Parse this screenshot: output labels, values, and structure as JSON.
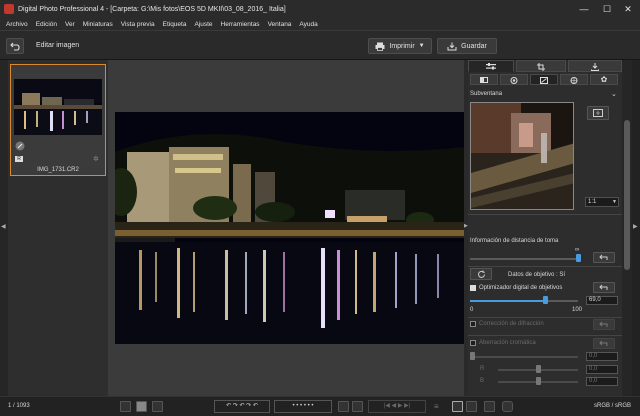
{
  "titlebar": {
    "title": "Digital Photo Professional 4 - [Carpeta: G:\\Mis fotos\\EOS 5D MKII\\03_08_2016_ Italia]",
    "minimize": "—",
    "maximize": "☐",
    "close": "✕"
  },
  "menu": {
    "items": [
      "Archivo",
      "Edición",
      "Ver",
      "Miniaturas",
      "Vista previa",
      "Etiqueta",
      "Ajuste",
      "Herramientas",
      "Ventana",
      "Ayuda"
    ]
  },
  "toolbar": {
    "back_icon": "back-arrow-icon",
    "mode_label": "Editar imagen",
    "print_label": "Imprimir",
    "save_label": "Guardar"
  },
  "filmstrip": {
    "thumb_filename": "IMG_1731.CR2",
    "thumb_badge": "R"
  },
  "panel": {
    "subwindow_label": "Subventana",
    "zoom_value": "1:1",
    "distance_label": "Información de distancia de toma",
    "lens_data_label": "Datos de objetivo : Sí",
    "dlo_label": "Optimizador digital de objetivos",
    "dlo_value": "69,0",
    "dlo_min": "0",
    "dlo_max": "100",
    "diffraction_label": "Corrección de difracción",
    "aberration_label": "Aberración cromática",
    "aberration_value": "0,0",
    "r_label": "R",
    "r_value": "0,0",
    "b_label": "B",
    "b_value": "0,0"
  },
  "status": {
    "count": "1 / 1093",
    "colorspace": "sRGB / sRGB"
  },
  "colors": {
    "accent": "#4a9ae0",
    "selection": "#d98a2b",
    "background": "#2d2d2d"
  }
}
